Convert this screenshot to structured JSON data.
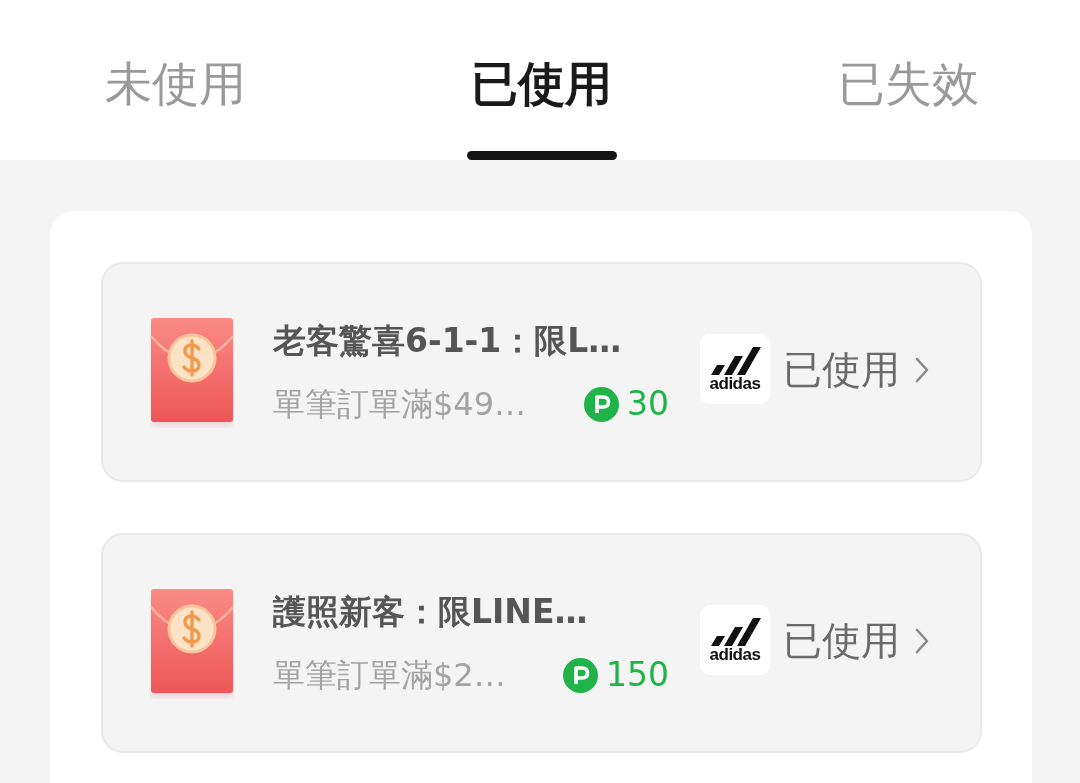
{
  "tabs": [
    {
      "label": "未使用",
      "selected": false
    },
    {
      "label": "已使用",
      "selected": true
    },
    {
      "label": "已失效",
      "selected": false
    }
  ],
  "coupons": [
    {
      "title": "老客驚喜6-1-1：限L…",
      "condition": "單筆訂單滿$49…",
      "points": "30",
      "brand_logo": "adidas",
      "status": "已使用"
    },
    {
      "title": "護照新客：限LINE…",
      "condition": "單筆訂單滿$2…",
      "points": "150",
      "brand_logo": "adidas",
      "status": "已使用"
    }
  ]
}
